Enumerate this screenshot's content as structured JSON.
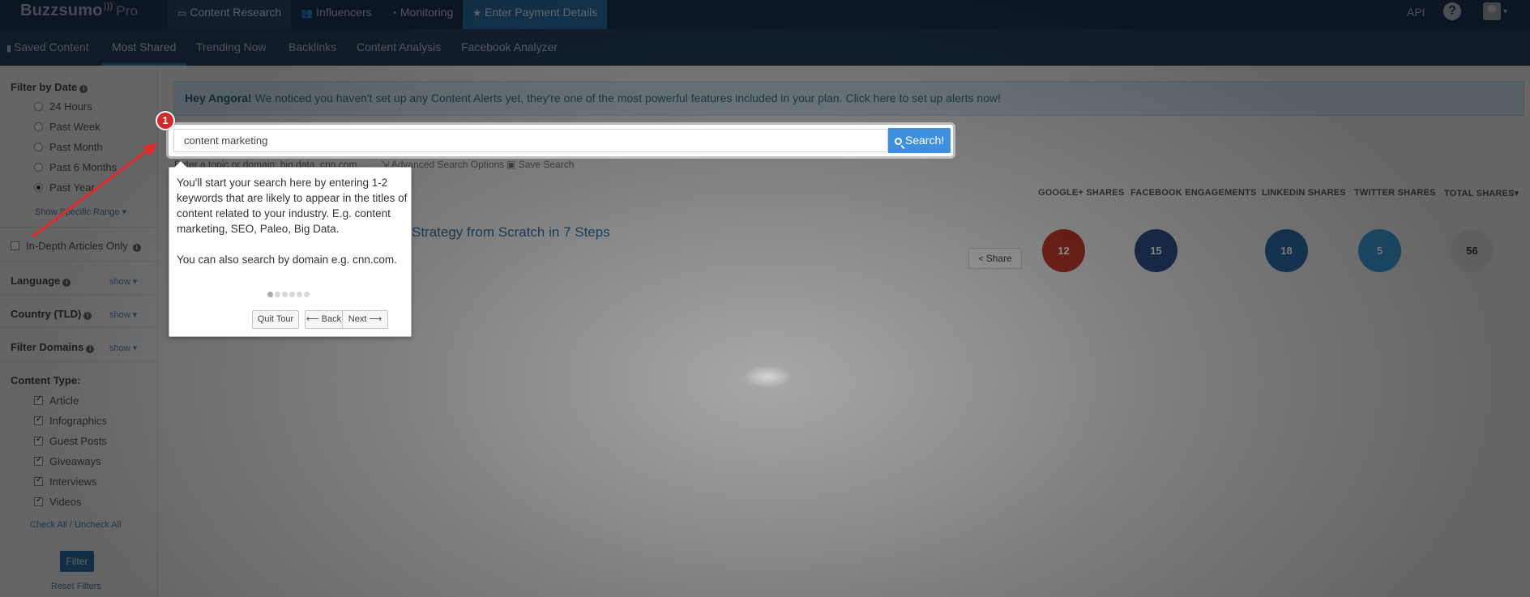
{
  "brand": {
    "name": "Buzzsumo",
    "tier": "Pro"
  },
  "top_nav": {
    "tabs": [
      {
        "label": "Content Research",
        "icon": "laptop-icon"
      },
      {
        "label": "Influencers",
        "icon": "users-icon"
      },
      {
        "label": "Monitoring",
        "icon": "dashboard-icon"
      },
      {
        "label": "Enter Payment Details",
        "icon": "star-icon"
      }
    ],
    "api_label": "API"
  },
  "sub_nav": {
    "items": [
      "Saved Content",
      "Most Shared",
      "Trending Now",
      "Backlinks",
      "Content Analysis",
      "Facebook Analyzer"
    ],
    "active": "Most Shared"
  },
  "sidebar": {
    "filter_by_date": {
      "title": "Filter by Date",
      "options": [
        "24 Hours",
        "Past Week",
        "Past Month",
        "Past 6 Months",
        "Past Year"
      ],
      "selected": "Past Year",
      "show_range_label": "Show Specific Range ▾"
    },
    "in_depth_label": "In-Depth Articles Only",
    "language_label": "Language",
    "country_label": "Country (TLD)",
    "domains_label": "Filter Domains",
    "show_label": "show ▾",
    "content_type": {
      "title": "Content Type:",
      "options": [
        "Article",
        "Infographics",
        "Guest Posts",
        "Giveaways",
        "Interviews",
        "Videos"
      ]
    },
    "check_all": "Check All",
    "uncheck_all": "Uncheck All",
    "check_sep": "/",
    "filter_button": "Filter",
    "reset_link": "Reset Filters"
  },
  "alert": {
    "greeting": "Hey Angora!",
    "message": "We noticed you haven't set up any Content Alerts yet, they're one of the most powerful features included in your plan. Click here to set up alerts now!"
  },
  "search": {
    "value": "content marketing",
    "button_label": "Search!",
    "hint": "Enter a topic or domain: big data, cnn.com",
    "advanced_label": "Advanced Search Options",
    "save_label": "Save Search"
  },
  "columns": [
    "GOOGLE+ SHARES",
    "FACEBOOK ENGAGEMENTS",
    "LINKEDIN SHARES",
    "TWITTER SHARES",
    "TOTAL SHARES"
  ],
  "result": {
    "title_fragment": "Strategy from Scratch in 7 Steps",
    "share_label": "Share",
    "google_plus": "12",
    "facebook": "15",
    "linkedin": "18",
    "twitter": "5",
    "total": "56"
  },
  "tour": {
    "step": "1",
    "paragraph1": "You'll start your search here by entering 1-2 keywords that are likely to appear in the titles of content related to your industry. E.g. content marketing, SEO, Paleo, Big Data.",
    "paragraph2": "You can also search by domain e.g. cnn.com.",
    "total_steps": 6,
    "current_step": 1,
    "quit_label": "Quit Tour",
    "back_label": "⟵ Back",
    "next_label": "Next ⟶"
  },
  "colors": {
    "topbar": "#1c3450",
    "accent": "#3d8fdf",
    "google_plus": "#c0392b",
    "facebook": "#2c4f86",
    "linkedin": "#2a6ba8",
    "twitter": "#3a9ad9",
    "total": "#e2e2e2",
    "marker": "#d72828"
  }
}
